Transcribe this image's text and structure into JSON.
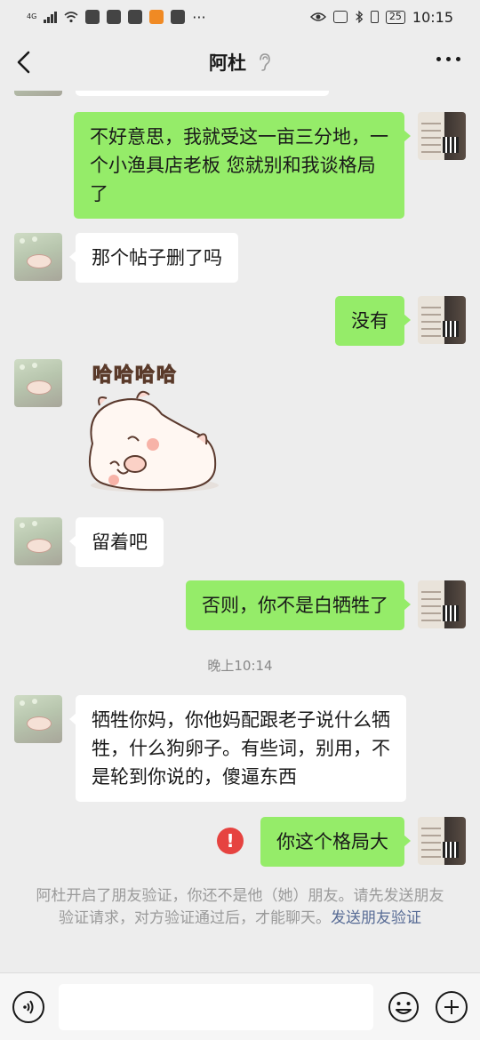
{
  "status_bar": {
    "network": "4G",
    "time": "10:15",
    "battery": "25"
  },
  "header": {
    "title": "阿杜",
    "back_icon": "chevron-left-icon",
    "ear_icon": "ear-icon",
    "more_icon": "more-dots-icon"
  },
  "messages": [
    {
      "side": "right",
      "text": "不好意思，我就受这一亩三分地，一个小渔具店老板 您就别和我谈格局了"
    },
    {
      "side": "left",
      "text": "那个帖子删了吗"
    },
    {
      "side": "right",
      "text": "没有"
    },
    {
      "side": "left",
      "type": "sticker",
      "text": "哈哈哈哈"
    },
    {
      "side": "left",
      "text": "留着吧"
    },
    {
      "side": "right",
      "text": "否则，你不是白牺牲了"
    },
    {
      "type": "timestamp",
      "text": "晚上10:14"
    },
    {
      "side": "left",
      "text": "牺牲你妈，你他妈配跟老子说什么牺牲，什么狗卵子。有些词，别用，不是轮到你说的，傻逼东西"
    },
    {
      "side": "right",
      "text": "你这个格局大",
      "status": "failed"
    }
  ],
  "system_note": {
    "text": "阿杜开启了朋友验证，你还不是他（她）朋友。请先发送朋友验证请求，对方验证通过后，才能聊天。",
    "link": "发送朋友验证"
  },
  "input_bar": {
    "voice_icon": "voice-icon",
    "emoji_icon": "emoji-icon",
    "plus_icon": "plus-icon",
    "placeholder": ""
  },
  "colors": {
    "background": "#ededed",
    "bubble_self": "#95ec69",
    "bubble_other": "#ffffff",
    "link": "#576b95",
    "error": "#e64340"
  }
}
